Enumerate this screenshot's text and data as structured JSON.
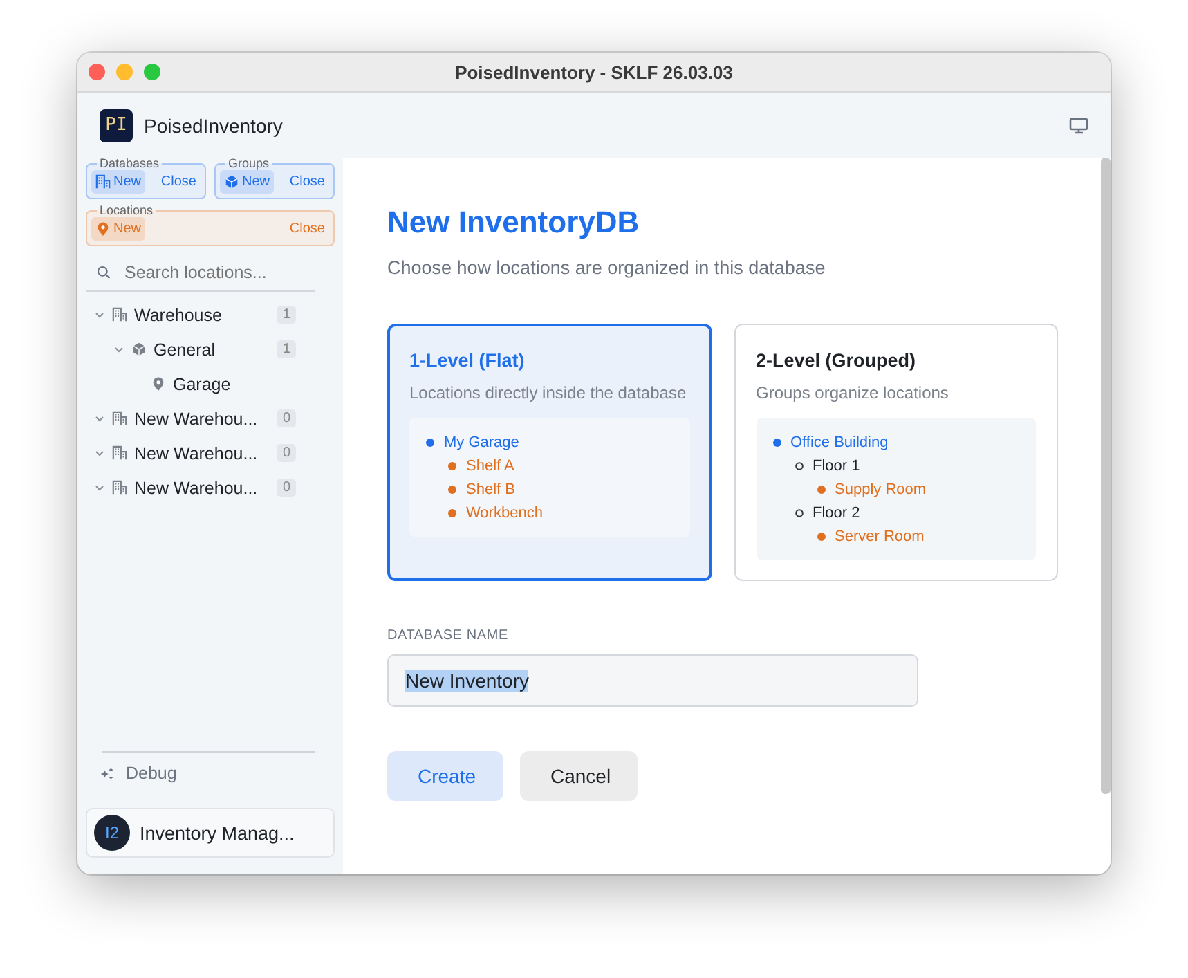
{
  "window": {
    "title": "PoisedInventory - SKLF 26.03.03"
  },
  "app": {
    "logo": "PI",
    "name": "PoisedInventory"
  },
  "sidebar": {
    "groups": [
      {
        "legend": "Databases",
        "kind": "database",
        "new": "New",
        "close": "Close"
      },
      {
        "legend": "Groups",
        "kind": "group",
        "new": "New",
        "close": "Close"
      },
      {
        "legend": "Locations",
        "kind": "location",
        "new": "New",
        "close": "Close"
      }
    ],
    "search": {
      "placeholder": "Search locations..."
    },
    "tree": [
      {
        "label": "Warehouse",
        "kind": "warehouse",
        "count": "1",
        "expanded": true,
        "children": [
          {
            "label": "General",
            "kind": "group",
            "count": "1",
            "expanded": true,
            "children": [
              {
                "label": "Garage",
                "kind": "location"
              }
            ]
          }
        ]
      },
      {
        "label": "New Warehou...",
        "kind": "warehouse",
        "count": "0",
        "expanded": true
      },
      {
        "label": "New Warehou...",
        "kind": "warehouse",
        "count": "0",
        "expanded": true
      },
      {
        "label": "New Warehou...",
        "kind": "warehouse",
        "count": "0",
        "expanded": true
      }
    ],
    "debug": "Debug",
    "account": {
      "avatar": "I2",
      "name": "Inventory Manag..."
    }
  },
  "main": {
    "title": "New InventoryDB",
    "subtitle": "Choose how locations are organized in this database",
    "options": [
      {
        "title": "1-Level (Flat)",
        "description": "Locations directly inside the database",
        "selected": true,
        "preview": [
          {
            "label": "My Garage",
            "kind": "root",
            "children": [
              {
                "label": "Shelf A",
                "kind": "location"
              },
              {
                "label": "Shelf B",
                "kind": "location"
              },
              {
                "label": "Workbench",
                "kind": "location"
              }
            ]
          }
        ]
      },
      {
        "title": "2-Level (Grouped)",
        "description": "Groups organize locations",
        "selected": false,
        "preview": [
          {
            "label": "Office Building",
            "kind": "root",
            "children": [
              {
                "label": "Floor 1",
                "kind": "group",
                "children": [
                  {
                    "label": "Supply Room",
                    "kind": "location"
                  }
                ]
              },
              {
                "label": "Floor 2",
                "kind": "group",
                "children": [
                  {
                    "label": "Server Room",
                    "kind": "location"
                  }
                ]
              }
            ]
          }
        ]
      }
    ],
    "name_field": {
      "label": "DATABASE NAME",
      "value": "New Inventory",
      "value_selected": true
    },
    "buttons": [
      {
        "label": "Create",
        "kind": "primary"
      },
      {
        "label": "Cancel",
        "kind": "secondary"
      }
    ]
  }
}
